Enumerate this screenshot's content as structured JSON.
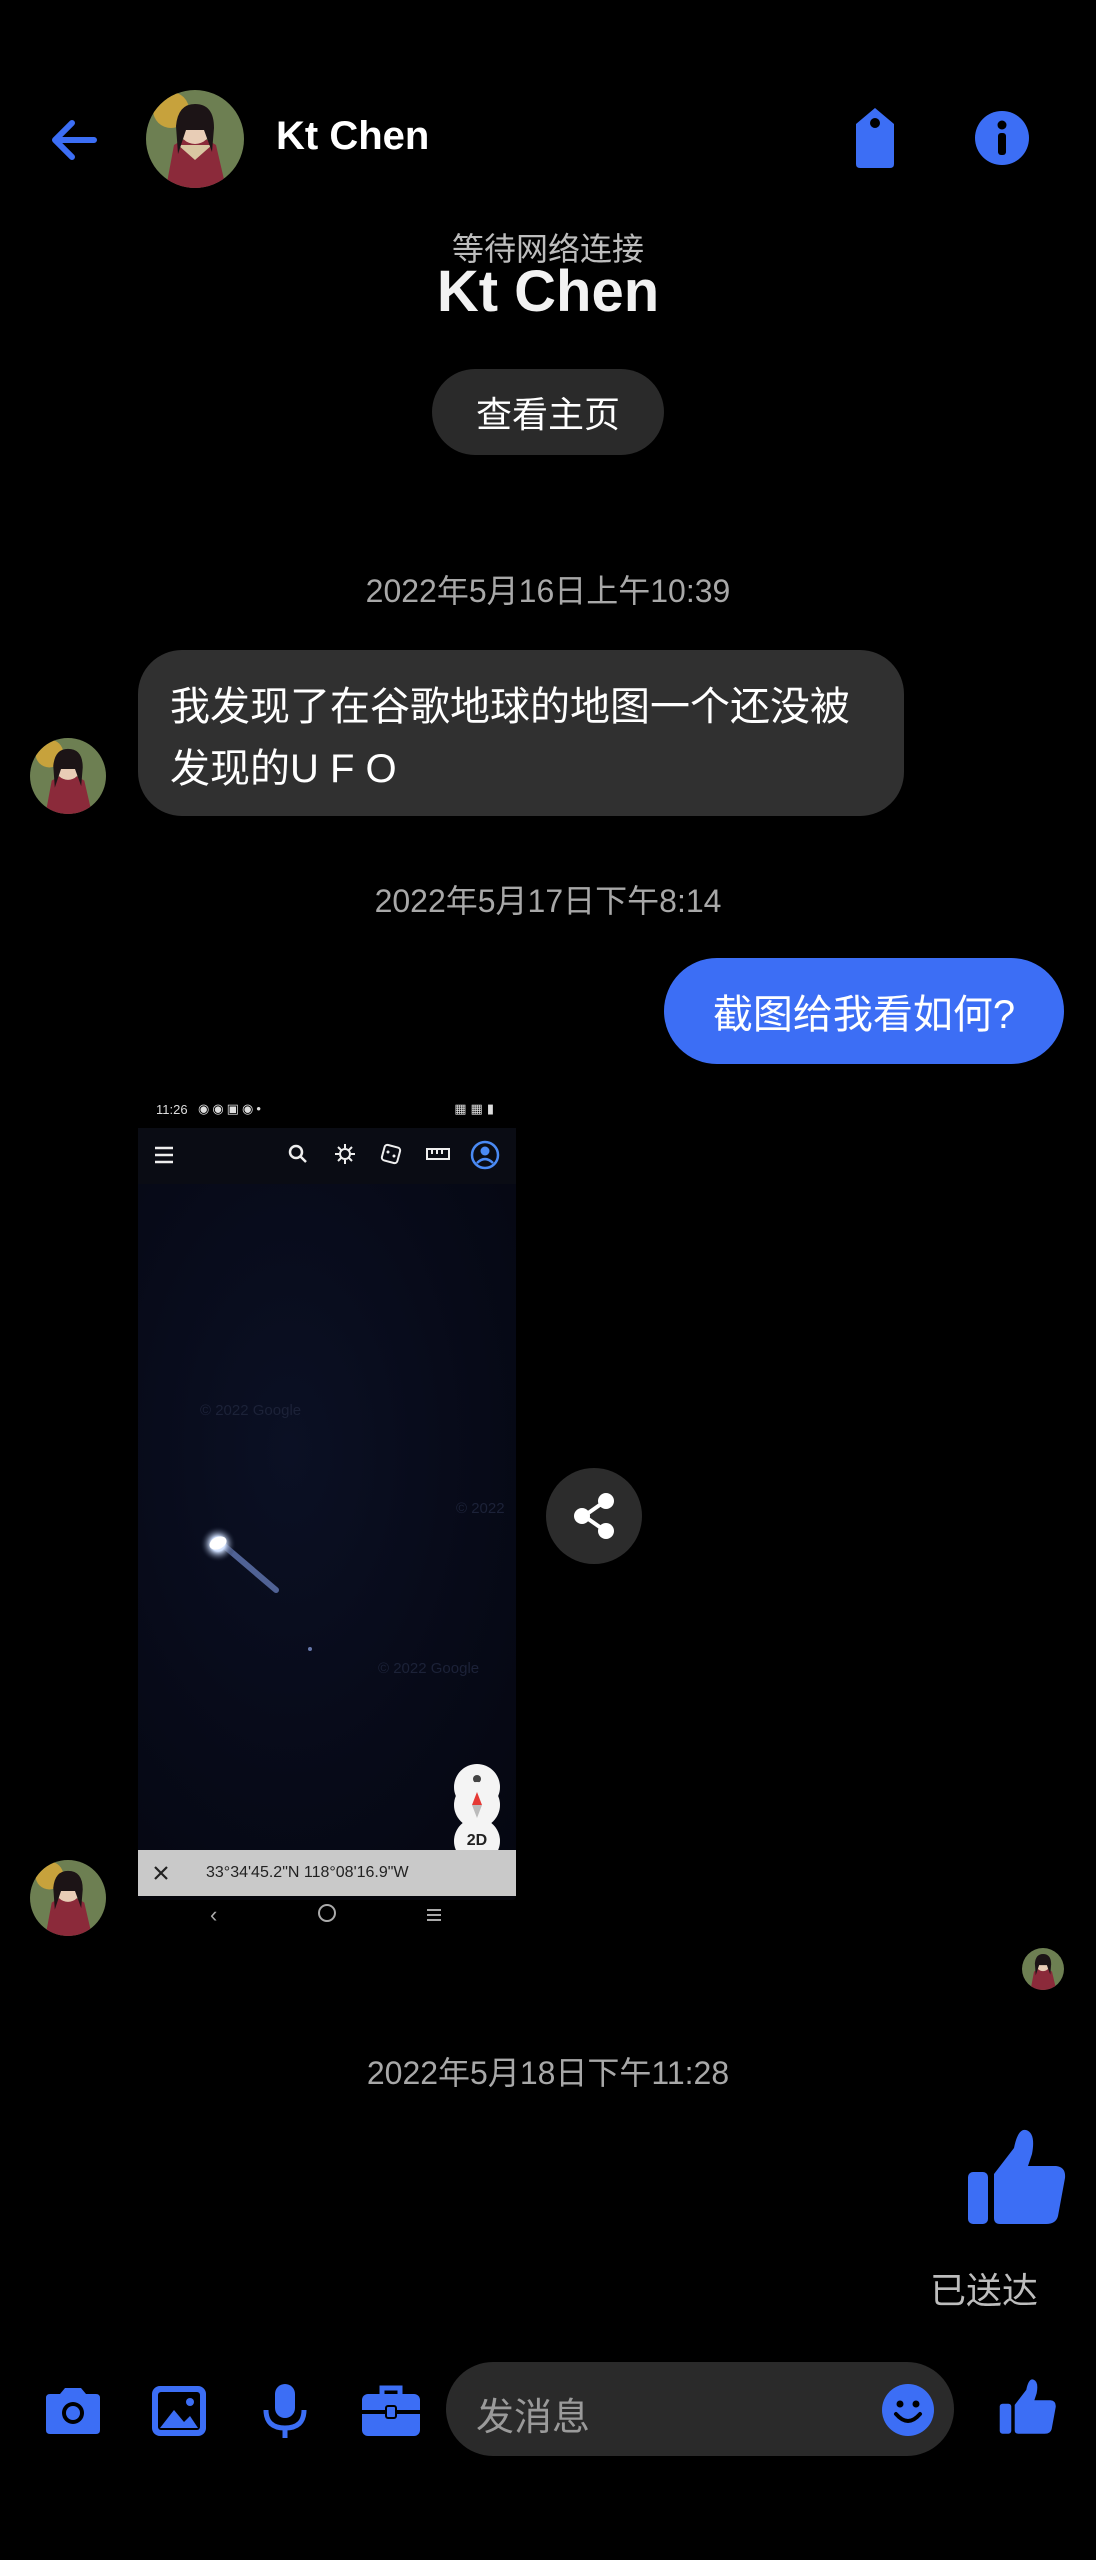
{
  "colors": {
    "accent": "#3c6ef5",
    "incoming_bubble": "#303030",
    "background": "#000000"
  },
  "header": {
    "contact_name": "Kt Chen",
    "network_status": "等待网络连接",
    "big_name": "Kt Chen",
    "view_profile_label": "查看主页",
    "icons": [
      "back-arrow-icon",
      "tag-icon",
      "info-icon"
    ]
  },
  "messages": [
    {
      "timestamp": "2022年5月16日上午10:39",
      "direction": "incoming",
      "text": "我发现了在谷歌地球的地图一个还没被发现的U F O"
    },
    {
      "timestamp": "2022年5月17日下午8:14",
      "direction": "outgoing",
      "text": "截图给我看如何?"
    },
    {
      "direction": "incoming",
      "type": "image",
      "image": {
        "status_time": "11:26",
        "watermarks": [
          "© 2022 Google",
          "© 2022",
          "© 2022 Google"
        ],
        "map_controls": [
          "pegman-icon",
          "2D",
          "compass-icon"
        ],
        "coordinates": "33°34'45.2\"N 118°08'16.9\"W"
      }
    },
    {
      "timestamp": "2022年5月18日下午11:28",
      "direction": "outgoing",
      "type": "like",
      "status": "已送达"
    }
  ],
  "composer": {
    "placeholder": "发消息",
    "icons": [
      "camera-icon",
      "gallery-icon",
      "microphone-icon",
      "briefcase-icon",
      "emoji-icon",
      "like-icon"
    ]
  }
}
